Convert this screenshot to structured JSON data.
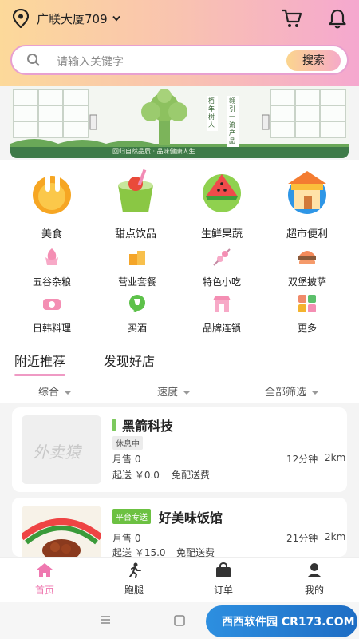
{
  "header": {
    "location": "广联大厦709",
    "icons": [
      "location-pin-icon",
      "chevron-down-icon",
      "cart-icon",
      "bell-icon"
    ]
  },
  "search": {
    "placeholder": "请输入关键字",
    "button": "搜索"
  },
  "banner": {
    "sign_left": "栢年树人",
    "sign_right": "翱引一流产品",
    "slogan": "回归自然品质 · 品味健康人生"
  },
  "categories_main": [
    {
      "label": "美食",
      "icon": "food-icon"
    },
    {
      "label": "甜点饮品",
      "icon": "dessert-drink-icon"
    },
    {
      "label": "生鲜果蔬",
      "icon": "watermelon-icon"
    },
    {
      "label": "超市便利",
      "icon": "store-icon"
    }
  ],
  "categories_small": [
    {
      "label": "五谷杂粮",
      "icon": "grain-icon"
    },
    {
      "label": "营业套餐",
      "icon": "combo-icon"
    },
    {
      "label": "特色小吃",
      "icon": "skewer-icon"
    },
    {
      "label": "双堡披萨",
      "icon": "burger-icon"
    },
    {
      "label": "日韩料理",
      "icon": "sushi-icon"
    },
    {
      "label": "买酒",
      "icon": "wine-icon"
    },
    {
      "label": "品牌连锁",
      "icon": "brand-shop-icon"
    },
    {
      "label": "更多",
      "icon": "grid-more-icon"
    }
  ],
  "tabs": {
    "nearby": "附近推荐",
    "discover": "发现好店"
  },
  "sort": {
    "general": "综合",
    "speed": "速度",
    "filter": "全部筛选"
  },
  "stores": [
    {
      "name": "黑箭科技",
      "status": "休息中",
      "sales": "月售 0",
      "min_order": "起送 ￥0.0",
      "delivery": "免配送费",
      "time": "12分钟",
      "distance": "2km",
      "thumb_text": "外卖猿"
    },
    {
      "name": "好美味饭馆",
      "badge": "平台专送",
      "sales": "月售 0",
      "min_order": "起送 ￥15.0",
      "delivery": "免配送费",
      "time": "21分钟",
      "distance": "2km"
    }
  ],
  "bottom_nav": [
    {
      "label": "首页",
      "icon": "home-icon",
      "active": true
    },
    {
      "label": "跑腿",
      "icon": "runner-icon"
    },
    {
      "label": "订单",
      "icon": "bag-icon"
    },
    {
      "label": "我的",
      "icon": "user-icon"
    }
  ],
  "watermark": "西西软件园 CR173.COM",
  "colors": {
    "accent": "#ef78b0",
    "green": "#6cc142"
  }
}
